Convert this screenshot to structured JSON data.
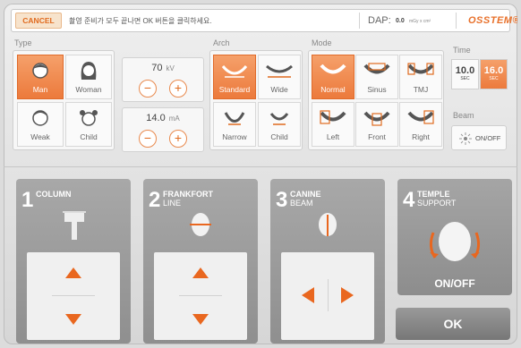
{
  "topbar": {
    "cancel_label": "CANCEL",
    "message": "촬영 준비가 모두 끝나면 OK 버튼을 클릭하세요.",
    "dap_label": "DAP:",
    "dap_value": "0.0",
    "dap_unit": "mGy x cm²",
    "logo": "OSSTEM®"
  },
  "type": {
    "label": "Type",
    "options": [
      {
        "label": "Man",
        "selected": true
      },
      {
        "label": "Woman",
        "selected": false
      },
      {
        "label": "Weak",
        "selected": false
      },
      {
        "label": "Child",
        "selected": false
      }
    ]
  },
  "kv": {
    "value": "70",
    "unit": "kV"
  },
  "ma": {
    "value": "14.0",
    "unit": "mA"
  },
  "arch": {
    "label": "Arch",
    "options": [
      {
        "label": "Standard",
        "selected": true
      },
      {
        "label": "Wide",
        "selected": false
      },
      {
        "label": "Narrow",
        "selected": false
      },
      {
        "label": "Child",
        "selected": false
      }
    ]
  },
  "mode": {
    "label": "Mode",
    "options": [
      {
        "label": "Normal",
        "selected": true
      },
      {
        "label": "Sinus",
        "selected": false
      },
      {
        "label": "TMJ",
        "selected": false
      },
      {
        "label": "Left",
        "selected": false
      },
      {
        "label": "Front",
        "selected": false
      },
      {
        "label": "Right",
        "selected": false
      }
    ]
  },
  "time": {
    "label": "Time",
    "options": [
      {
        "value": "10.0",
        "unit": "SEC",
        "selected": false
      },
      {
        "value": "16.0",
        "unit": "SEC",
        "selected": true
      }
    ]
  },
  "beam": {
    "label": "Beam",
    "button_label": "ON/OFF"
  },
  "steps": [
    {
      "number": "1",
      "title": "COLUMN",
      "subtitle": ""
    },
    {
      "number": "2",
      "title": "FRANKFORT",
      "subtitle": "LINE"
    },
    {
      "number": "3",
      "title": "CANINE",
      "subtitle": "BEAM"
    },
    {
      "number": "4",
      "title": "TEMPLE",
      "subtitle": "SUPPORT",
      "button_label": "ON/OFF"
    }
  ],
  "ok_label": "OK",
  "colors": {
    "accent": "#ec7a3c",
    "card": "#999999"
  }
}
